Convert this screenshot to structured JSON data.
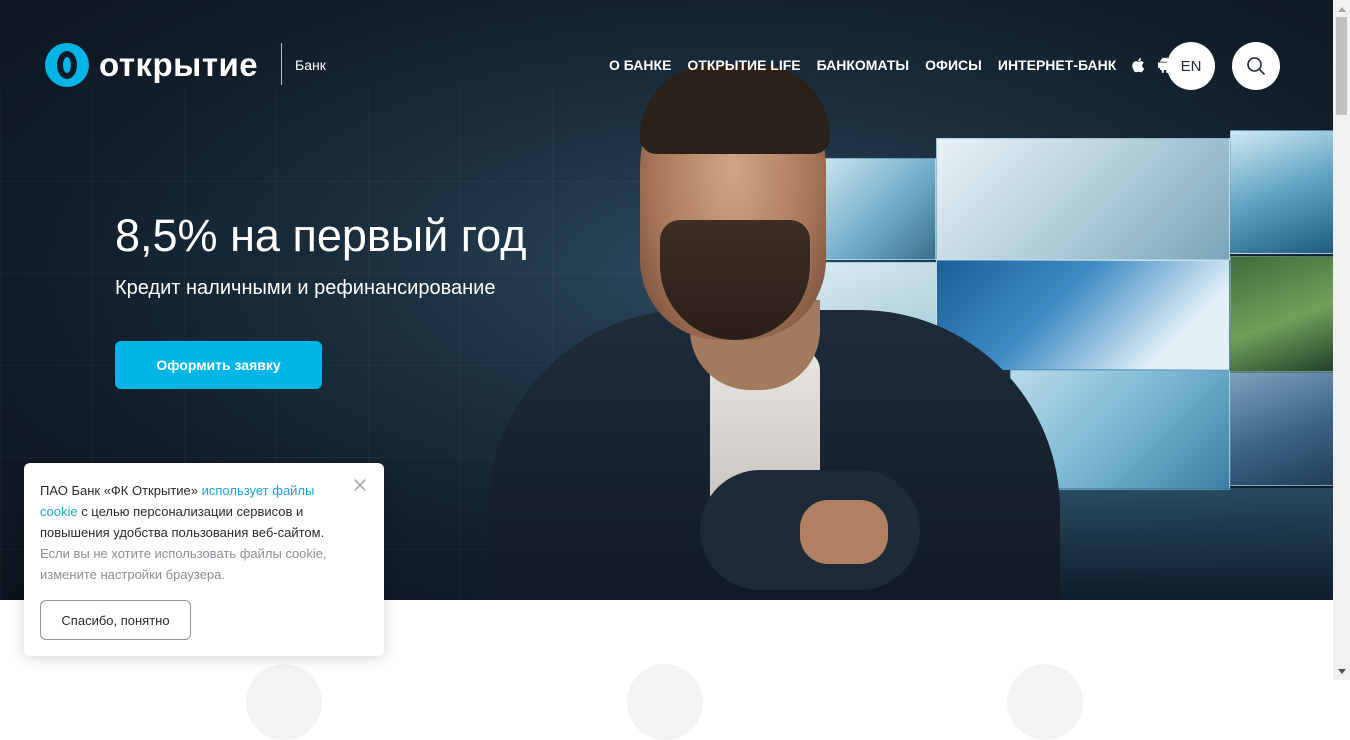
{
  "header": {
    "logo_text": "открытие",
    "logo_sub": "Банк",
    "nav": [
      "О БАНКЕ",
      "ОТКРЫТИЕ LIFE",
      "БАНКОМАТЫ",
      "ОФИСЫ",
      "ИНТЕРНЕТ-БАНК"
    ],
    "lang": "EN"
  },
  "hero": {
    "title": "8,5% на первый год",
    "subtitle": "Кредит наличными и рефинансирование",
    "cta": "Оформить заявку"
  },
  "cookie": {
    "text1": "ПАО Банк «ФК Открытие» ",
    "link": "использует файлы cookie",
    "text2": " с целью персонализации сервисов и повышения удобства пользования веб-сайтом.",
    "muted": "Если вы не хотите использовать файлы cookie, измените настройки браузера.",
    "button": "Спасибо, понятно"
  },
  "colors": {
    "accent": "#00b6e6",
    "link": "#1aa3d8"
  },
  "icons": [
    "apple-icon",
    "android-icon",
    "search-icon",
    "close-icon"
  ]
}
